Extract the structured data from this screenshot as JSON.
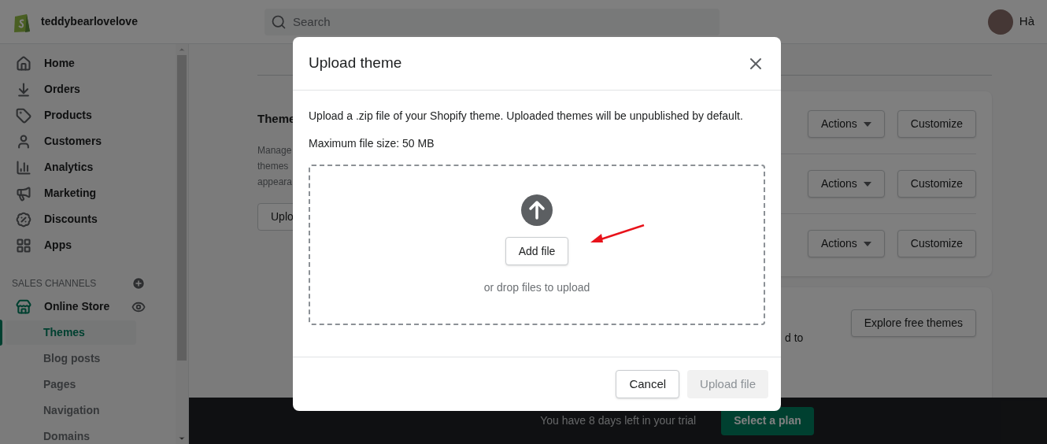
{
  "store_name": "teddybearlovelove",
  "search": {
    "placeholder": "Search"
  },
  "user": {
    "name": "Hà"
  },
  "sidebar": {
    "items": [
      {
        "label": "Home",
        "selected": false
      },
      {
        "label": "Orders",
        "selected": false
      },
      {
        "label": "Products",
        "selected": false
      },
      {
        "label": "Customers",
        "selected": false
      },
      {
        "label": "Analytics",
        "selected": false
      },
      {
        "label": "Marketing",
        "selected": false
      },
      {
        "label": "Discounts",
        "selected": false
      },
      {
        "label": "Apps",
        "selected": false
      }
    ],
    "sales_channels": {
      "heading": "SALES CHANNELS",
      "items": [
        {
          "label": "Online Store",
          "selected": false,
          "children": [
            {
              "label": "Themes",
              "selected": true
            },
            {
              "label": "Blog posts",
              "selected": false
            },
            {
              "label": "Pages",
              "selected": false
            },
            {
              "label": "Navigation",
              "selected": false
            },
            {
              "label": "Domains",
              "selected": false
            }
          ]
        }
      ]
    }
  },
  "themes_section": {
    "title": "Theme",
    "description_lines": [
      "Manage",
      "themes",
      "appeara"
    ],
    "button": "Uplo"
  },
  "theme_rows": [
    {
      "actions": "Actions",
      "customize": "Customize"
    },
    {
      "actions": "Actions",
      "customize": "Customize"
    },
    {
      "actions": "Actions",
      "customize": "Customize"
    }
  ],
  "free_themes": {
    "text": "d to",
    "button": "Explore free themes"
  },
  "trial_bar": {
    "text": "You have 8 days left in your trial",
    "button": "Select a plan"
  },
  "modal": {
    "title": "Upload theme",
    "description": "Upload a .zip file of your Shopify theme. Uploaded themes will be unpublished by default.",
    "max_size": "Maximum file size: 50 MB",
    "add_button": "Add file",
    "drop_hint": "or drop files to upload",
    "cancel": "Cancel",
    "submit": {
      "label": "Upload file",
      "disabled": true
    }
  }
}
